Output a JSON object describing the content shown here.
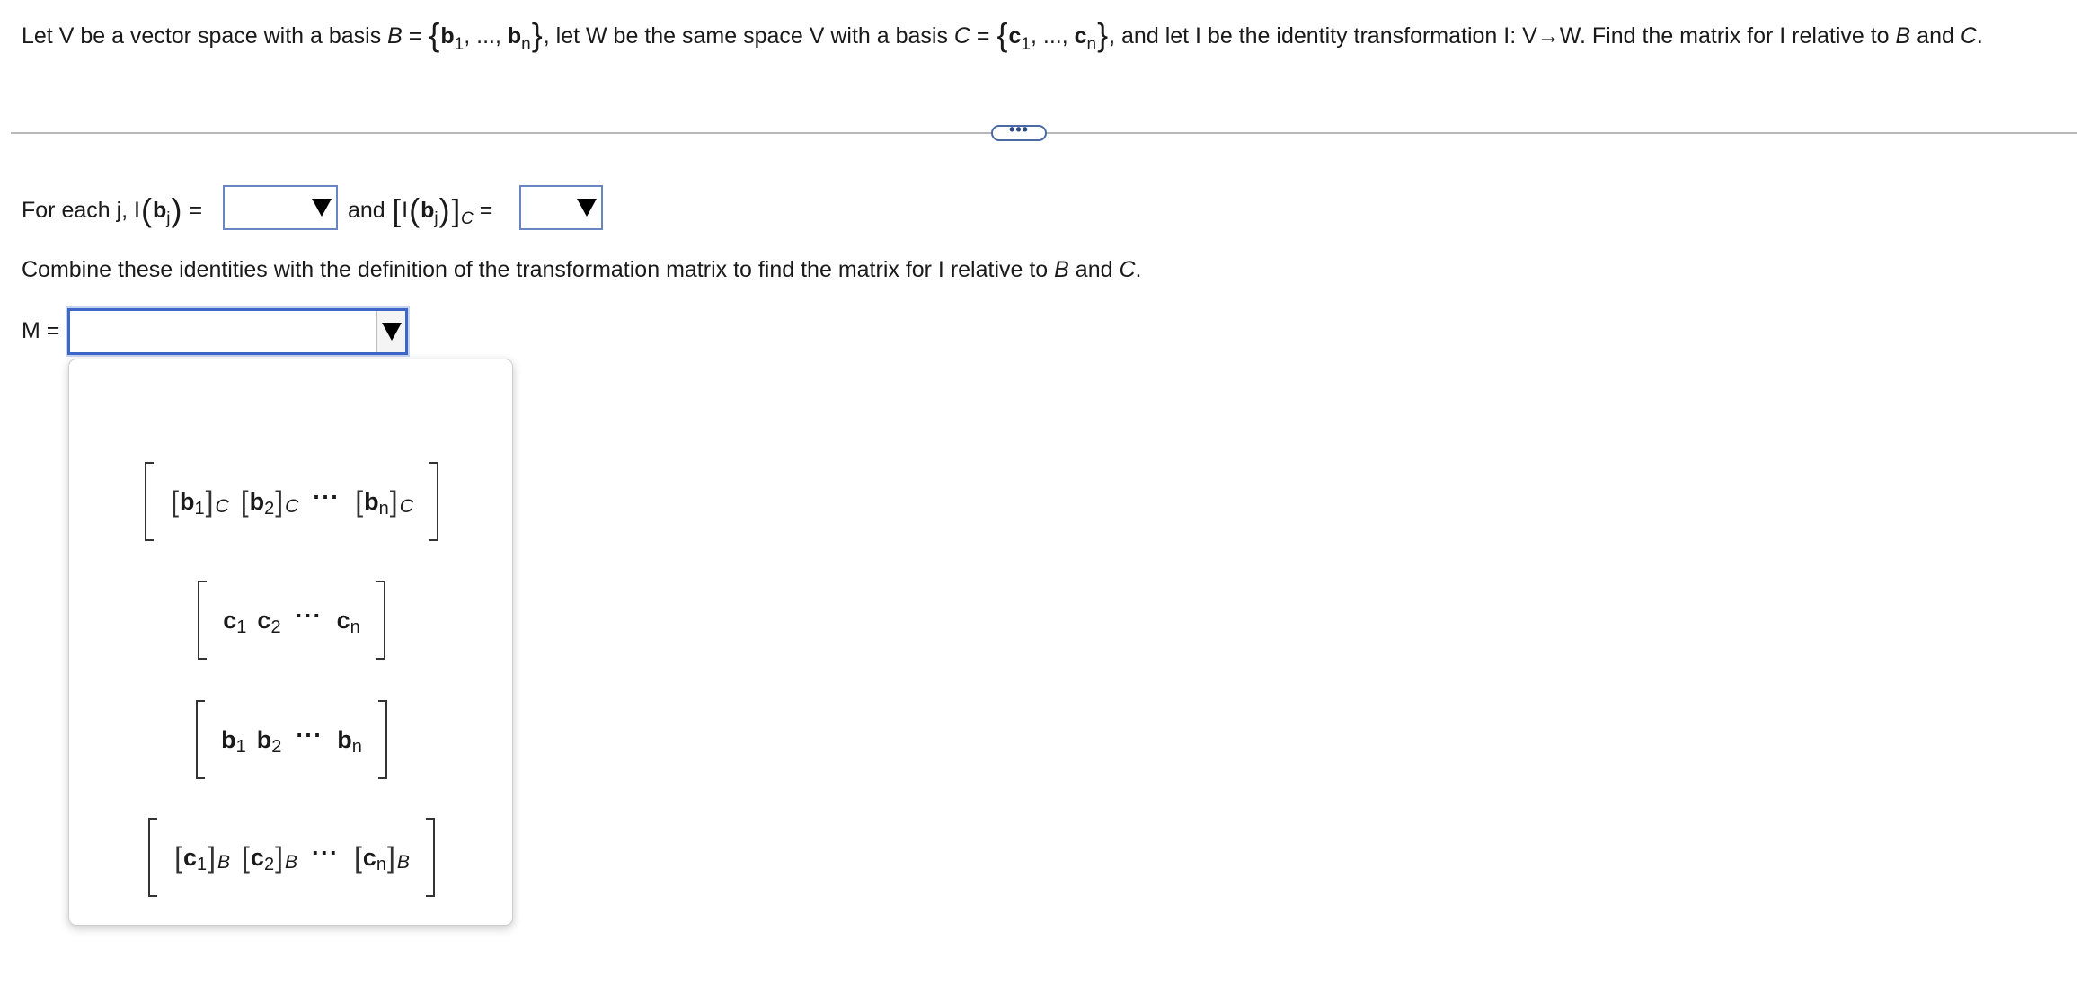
{
  "question": {
    "t1": "Let V be a vector space with a basis ",
    "B": "B",
    "eq1": " = ",
    "b": "b",
    "sub1": "1",
    "ellipsis": ", ..., ",
    "subn": "n",
    "t2": ", let W be the same space V with a basis ",
    "C": "C",
    "c": "c",
    "t3": ", and let I be the identity transformation I: V→W. Find the matrix for I relative to ",
    "and": " and ",
    "period": "."
  },
  "divider": {
    "more_label": "•••"
  },
  "step1": {
    "prefix": "For each j, I",
    "b": "b",
    "j": "j",
    "eq": " =",
    "and": "and",
    "I": "I",
    "C": "C",
    "eq2": " ="
  },
  "step2": {
    "text": "Combine these identities with the definition of the transformation matrix to find the matrix for I relative to ",
    "B": "B",
    "and": " and ",
    "C": "C",
    "period": "."
  },
  "answer": {
    "label": "M ="
  },
  "menu": {
    "options": [
      {
        "id": "bj-coords-in-C",
        "vec": "b",
        "subs": [
          "1",
          "2",
          "n"
        ],
        "coord": "C"
      },
      {
        "id": "c-vectors",
        "vec": "c",
        "subs": [
          "1",
          "2",
          "n"
        ],
        "coord": ""
      },
      {
        "id": "b-vectors",
        "vec": "b",
        "subs": [
          "1",
          "2",
          "n"
        ],
        "coord": ""
      },
      {
        "id": "cj-coords-in-B",
        "vec": "c",
        "subs": [
          "1",
          "2",
          "n"
        ],
        "coord": "B"
      }
    ],
    "dots": "···"
  },
  "colors": {
    "focus_border": "#3d66c7",
    "text": "#1a1a1a",
    "divider": "#b7b7b7"
  }
}
